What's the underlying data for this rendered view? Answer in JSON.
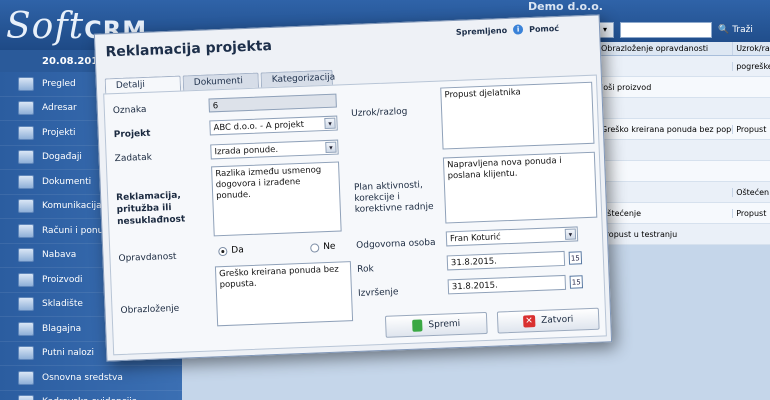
{
  "app": {
    "logo_soft": "Soft",
    "logo_crm": "CRM",
    "company": "Demo d.o.o.",
    "date": "20.08.2015 0"
  },
  "sidebar": {
    "items": [
      {
        "label": "Pregled",
        "icon": "overview-icon"
      },
      {
        "label": "Adresar",
        "icon": "address-book-icon"
      },
      {
        "label": "Projekti",
        "icon": "projects-icon"
      },
      {
        "label": "Događaji",
        "icon": "events-icon"
      },
      {
        "label": "Dokumenti",
        "icon": "documents-icon"
      },
      {
        "label": "Komunikacija",
        "icon": "communication-icon"
      },
      {
        "label": "Računi i ponude",
        "icon": "invoices-icon"
      },
      {
        "label": "Nabava",
        "icon": "procurement-icon"
      },
      {
        "label": "Proizvodi",
        "icon": "products-icon"
      },
      {
        "label": "Skladište",
        "icon": "warehouse-icon"
      },
      {
        "label": "Blagajna",
        "icon": "cash-register-icon"
      },
      {
        "label": "Putni nalozi",
        "icon": "travel-orders-icon"
      },
      {
        "label": "Osnovna sredstva",
        "icon": "assets-icon"
      },
      {
        "label": "Kadrovska evidencija",
        "icon": "hr-icon"
      }
    ]
  },
  "toolbar": {
    "search_label": "Traži"
  },
  "grid": {
    "headers": [
      "Obrazloženje opravdanosti",
      "Uzrok/ra"
    ],
    "rows": [
      [
        "",
        "pogreške"
      ],
      [
        "loši proizvod",
        ""
      ],
      [
        "",
        ""
      ],
      [
        "Greško kreirana ponuda bez popusta.",
        "Propust"
      ],
      [
        "",
        ""
      ],
      [
        "",
        ""
      ],
      [
        "",
        "Oštećen"
      ],
      [
        "Oštećenje",
        "Propust"
      ],
      [
        "Propust u testranju",
        ""
      ]
    ]
  },
  "dialog": {
    "title": "Reklamacija projekta",
    "save_status": "Spremljeno",
    "help_label": "Pomoć",
    "tabs": [
      "Detalji",
      "Dokumenti",
      "Kategorizacija"
    ],
    "labels": {
      "oznaka": "Oznaka",
      "projekt": "Projekt",
      "zadatak": "Zadatak",
      "reklamacija": "Reklamacija, pritužba ili nesuklađnost",
      "opravdanost": "Opravdanost",
      "obrazlozenje": "Obrazloženje",
      "uzrok": "Uzrok/razlog",
      "plan": "Plan aktivnosti, korekcije i korektivne radnje",
      "odgovorna": "Odgovorna osoba",
      "rok": "Rok",
      "izvrsenje": "Izvršenje"
    },
    "values": {
      "oznaka": "6",
      "projekt": "ABC d.o.o. - A projekt",
      "zadatak": "Izrada ponude.",
      "reklamacija": "Razlika između usmenog dogovora i izrađene ponude.",
      "opravdanost_yes": "Da",
      "opravdanost_no": "Ne",
      "obrazlozenje": "Greško kreirana ponuda bez popusta.",
      "uzrok": "Propust djelatnika",
      "plan": "Napravljena nova ponuda i poslana klijentu.",
      "odgovorna": "Fran Koturić",
      "rok": "31.8.2015.",
      "izvrsenje": "31.8.2015.",
      "calendar": "15"
    },
    "buttons": {
      "save": "Spremi",
      "close": "Zatvori"
    }
  }
}
